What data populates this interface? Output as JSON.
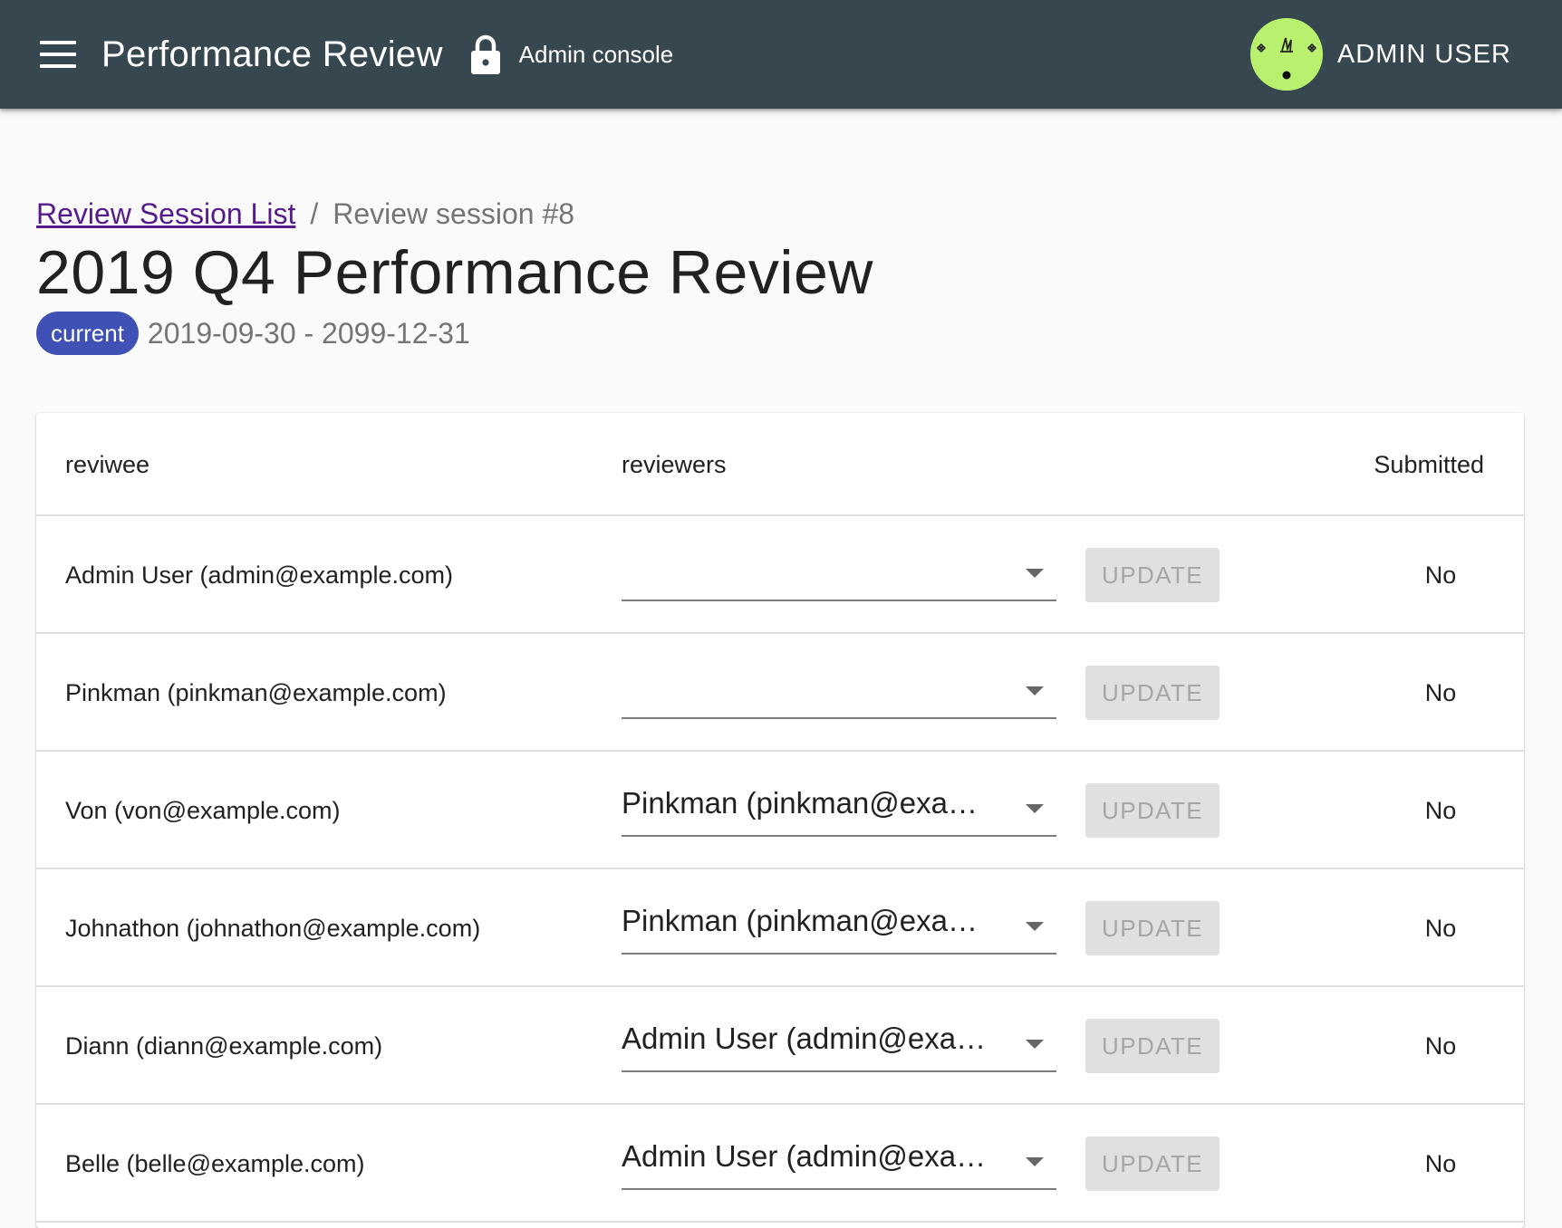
{
  "appbar": {
    "title": "Performance Review",
    "console_label": "Admin console",
    "user_name": "ADMIN USER"
  },
  "breadcrumb": {
    "link_label": "Review Session List",
    "separator": "/",
    "current": "Review session #8"
  },
  "session": {
    "title": "2019 Q4 Performance Review",
    "status_badge": "current",
    "date_range": "2019-09-30 - 2099-12-31"
  },
  "table": {
    "headers": {
      "reviewee": "reviwee",
      "reviewers": "reviewers",
      "submitted": "Submitted"
    },
    "rows": [
      {
        "reviewee": "Admin User (admin@example.com)",
        "reviewer": "",
        "update_label": "UPDATE",
        "submitted": "No"
      },
      {
        "reviewee": "Pinkman (pinkman@example.com)",
        "reviewer": "",
        "update_label": "UPDATE",
        "submitted": "No"
      },
      {
        "reviewee": "Von (von@example.com)",
        "reviewer": "Pinkman (pinkman@exam…",
        "update_label": "UPDATE",
        "submitted": "No"
      },
      {
        "reviewee": "Johnathon (johnathon@example.com)",
        "reviewer": "Pinkman (pinkman@exam…",
        "update_label": "UPDATE",
        "submitted": "No"
      },
      {
        "reviewee": "Diann (diann@example.com)",
        "reviewer": "Admin User (admin@exam…",
        "update_label": "UPDATE",
        "submitted": "No"
      },
      {
        "reviewee": "Belle (belle@example.com)",
        "reviewer": "Admin User (admin@exam…",
        "update_label": "UPDATE",
        "submitted": "No"
      }
    ]
  },
  "colors": {
    "appbar": "#37474f",
    "badge": "#3f51b5",
    "avatar": "#b9f06e",
    "link": "#551a8b",
    "button_disabled_bg": "#e0e0e0",
    "button_disabled_text": "#a6a6a6"
  },
  "icons": [
    "menu-icon",
    "lock-icon",
    "avatar-face-icon",
    "chevron-down-icon"
  ]
}
